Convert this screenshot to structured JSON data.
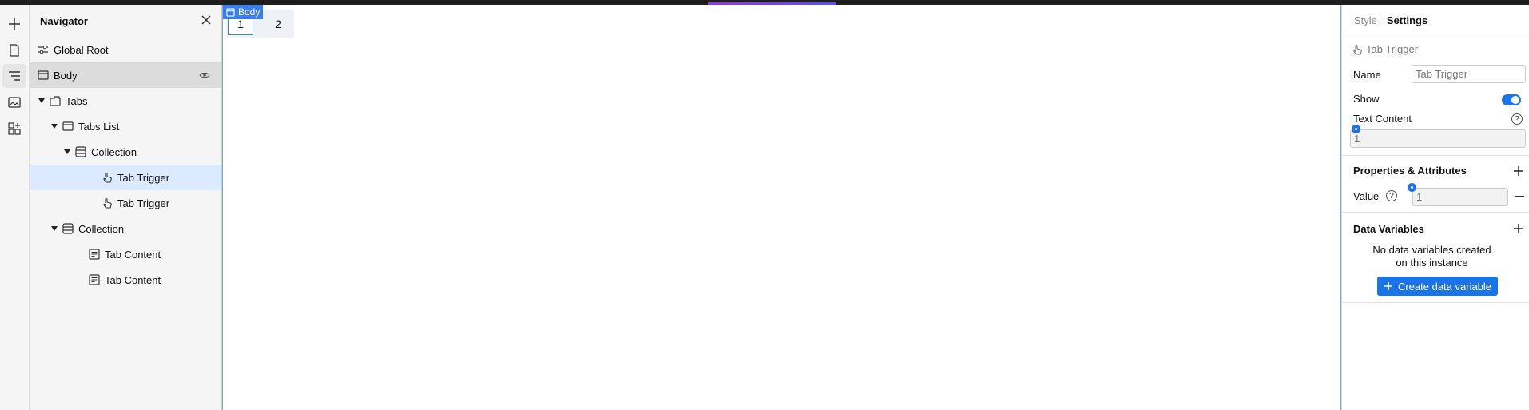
{
  "navigator": {
    "title": "Navigator",
    "tree": [
      {
        "label": "Global Root",
        "icon": "sliders-icon"
      },
      {
        "label": "Body",
        "icon": "body-box-icon"
      },
      {
        "label": "Tabs",
        "icon": "tabs-icon"
      },
      {
        "label": "Tabs List",
        "icon": "box-icon"
      },
      {
        "label": "Collection",
        "icon": "collection-icon"
      },
      {
        "label": "Tab Trigger",
        "icon": "pointer-hand-icon"
      },
      {
        "label": "Tab Trigger",
        "icon": "pointer-hand-icon"
      },
      {
        "label": "Collection",
        "icon": "collection-icon"
      },
      {
        "label": "Tab Content",
        "icon": "text-block-icon"
      },
      {
        "label": "Tab Content",
        "icon": "text-block-icon"
      }
    ]
  },
  "canvas": {
    "badge": "Body",
    "tabs": [
      "1",
      "2"
    ]
  },
  "panel": {
    "tabs": [
      "Style",
      "Settings"
    ],
    "active_tab": "Settings",
    "component": "Tab Trigger",
    "name_label": "Name",
    "name_placeholder": "Tab Trigger",
    "show_label": "Show",
    "show_on": true,
    "text_content_label": "Text Content",
    "text_content_value": "1",
    "props_title": "Properties & Attributes",
    "value_label": "Value",
    "value_value": "1",
    "data_vars_title": "Data Variables",
    "empty_note": "No data variables created on this instance",
    "create_button": "Create data variable",
    "help_glyph": "?"
  },
  "colors": {
    "accent": "#1a73e8",
    "selection": "#3b7ef0"
  }
}
